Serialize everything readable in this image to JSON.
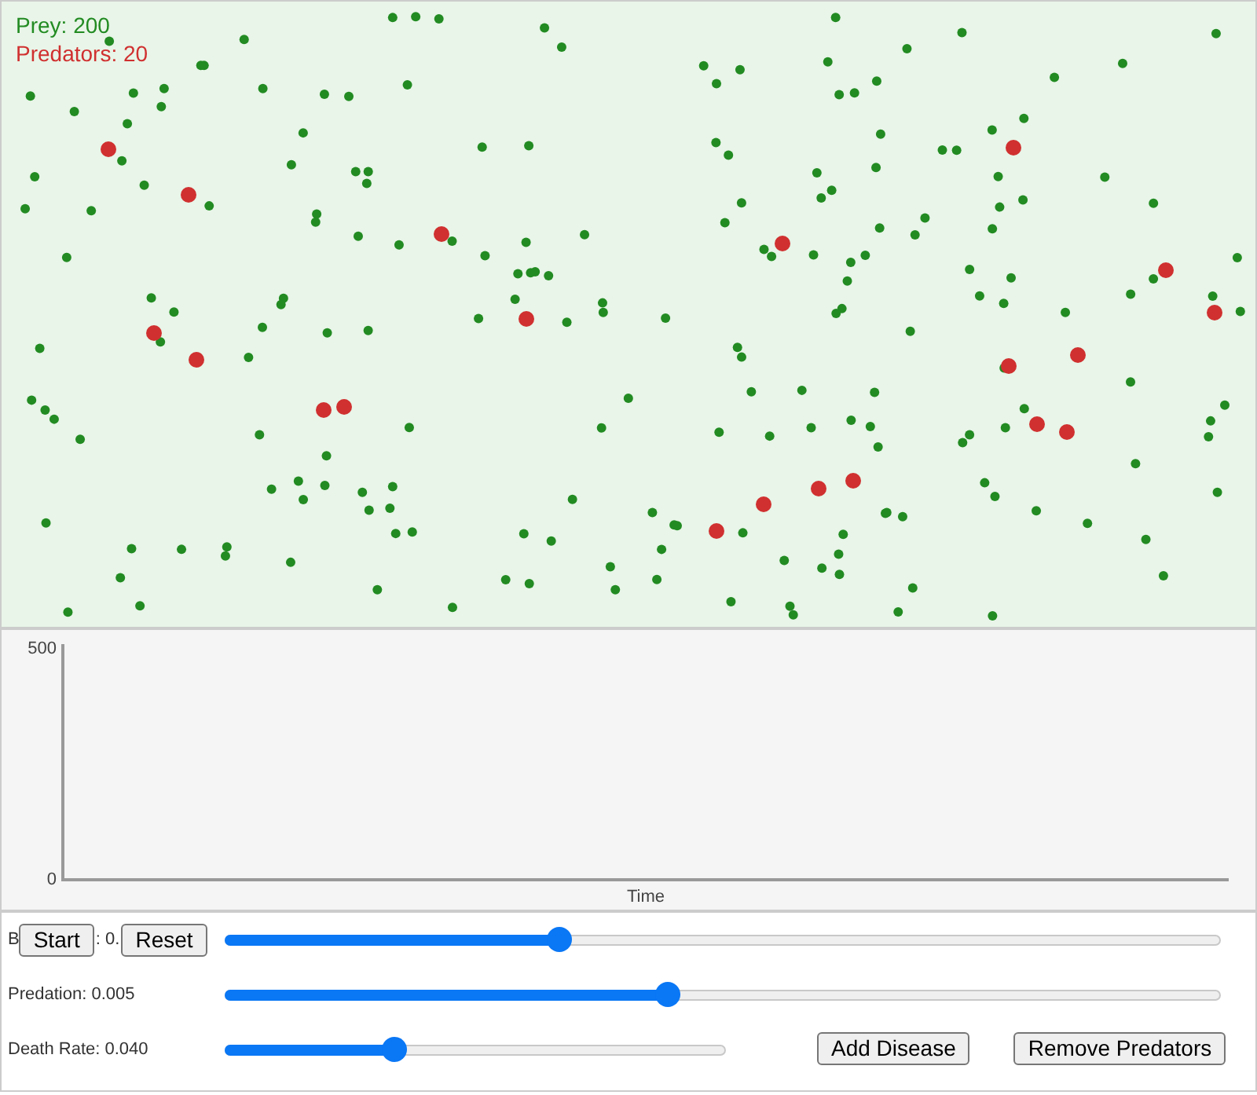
{
  "simulation": {
    "prey_label": "Prey: 200",
    "predators_label": "Predators: 20"
  },
  "chart": {
    "y_axis_labels": [
      "500",
      "0"
    ],
    "x_axis_label": "Time"
  },
  "controls": {
    "rows": [
      {
        "kind": "buttons",
        "label_parts": [
          "B",
          ": 0."
        ],
        "buttons": [
          "Start",
          "Reset"
        ],
        "level": 0.336
      },
      {
        "kind": "slider",
        "label": "Predation: 0.005",
        "level": 0.445
      },
      {
        "kind": "short",
        "label": "Death Rate: 0.040",
        "level": 0.34,
        "buttons": [
          "Add Disease",
          "Remove Predators"
        ]
      }
    ]
  }
}
